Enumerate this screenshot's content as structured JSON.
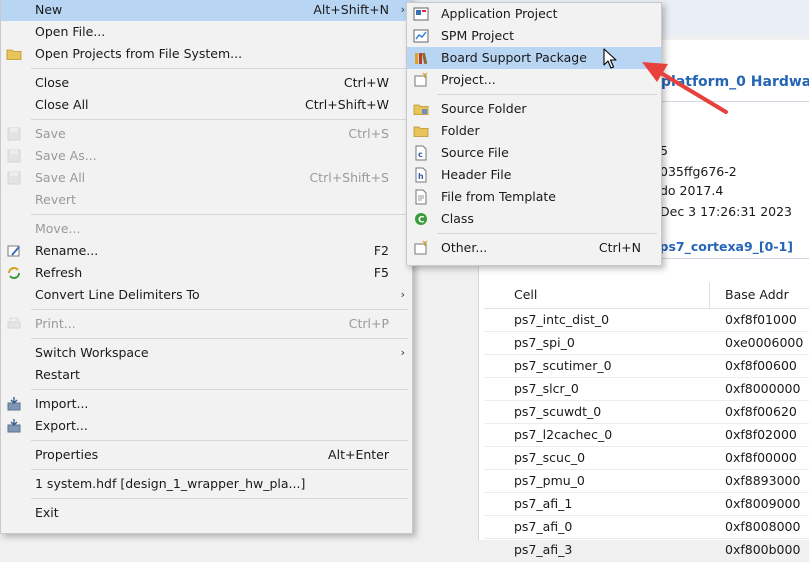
{
  "background": {
    "editor_title": "platform_0 Hardwa",
    "info_lines": [
      "5",
      "035ffg676-2",
      "do 2017.4",
      "Dec  3 17:26:31 2023"
    ],
    "section_link": "r ps7_cortexa9_[0-1]",
    "table": {
      "headers": [
        "Cell",
        "Base Addr"
      ],
      "rows": [
        [
          "ps7_intc_dist_0",
          "0xf8f01000"
        ],
        [
          "ps7_spi_0",
          "0xe0006000"
        ],
        [
          "ps7_scutimer_0",
          "0xf8f00600"
        ],
        [
          "ps7_slcr_0",
          "0xf8000000"
        ],
        [
          "ps7_scuwdt_0",
          "0xf8f00620"
        ],
        [
          "ps7_l2cachec_0",
          "0xf8f02000"
        ],
        [
          "ps7_scuc_0",
          "0xf8f00000"
        ],
        [
          "ps7_pmu_0",
          "0xf8893000"
        ],
        [
          "ps7_afi_1",
          "0xf8009000"
        ],
        [
          "ps7_afi_0",
          "0xf8008000"
        ],
        [
          "ps7_afi_3",
          "0xf800b000"
        ]
      ]
    }
  },
  "main_menu": [
    {
      "label": "New",
      "accel": "Alt+Shift+N",
      "submenu": true,
      "highlighted": true,
      "icon": ""
    },
    {
      "label": "Open File...",
      "accel": "",
      "icon": ""
    },
    {
      "label": "Open Projects from File System...",
      "accel": "",
      "icon": "folder-icon"
    },
    {
      "separator": true
    },
    {
      "label": "Close",
      "accel": "Ctrl+W",
      "icon": ""
    },
    {
      "label": "Close All",
      "accel": "Ctrl+Shift+W",
      "icon": ""
    },
    {
      "separator": true
    },
    {
      "label": "Save",
      "accel": "Ctrl+S",
      "disabled": true,
      "icon": "save-icon"
    },
    {
      "label": "Save As...",
      "accel": "",
      "disabled": true,
      "icon": "save-as-icon"
    },
    {
      "label": "Save All",
      "accel": "Ctrl+Shift+S",
      "disabled": true,
      "icon": "save-all-icon"
    },
    {
      "label": "Revert",
      "accel": "",
      "disabled": true,
      "icon": ""
    },
    {
      "separator": true
    },
    {
      "label": "Move...",
      "accel": "",
      "disabled": true,
      "icon": ""
    },
    {
      "label": "Rename...",
      "accel": "F2",
      "icon": "rename-icon"
    },
    {
      "label": "Refresh",
      "accel": "F5",
      "icon": "refresh-icon"
    },
    {
      "label": "Convert Line Delimiters To",
      "accel": "",
      "submenu": true,
      "icon": ""
    },
    {
      "separator": true
    },
    {
      "label": "Print...",
      "accel": "Ctrl+P",
      "disabled": true,
      "icon": "print-icon"
    },
    {
      "separator": true
    },
    {
      "label": "Switch Workspace",
      "accel": "",
      "submenu": true,
      "icon": ""
    },
    {
      "label": "Restart",
      "accel": "",
      "icon": ""
    },
    {
      "separator": true
    },
    {
      "label": "Import...",
      "accel": "",
      "icon": "import-icon"
    },
    {
      "label": "Export...",
      "accel": "",
      "icon": "export-icon"
    },
    {
      "separator": true
    },
    {
      "label": "Properties",
      "accel": "Alt+Enter",
      "icon": ""
    },
    {
      "separator": true
    },
    {
      "label": "1 system.hdf  [design_1_wrapper_hw_pla...]",
      "accel": "",
      "icon": ""
    },
    {
      "separator": true
    },
    {
      "label": "Exit",
      "accel": "",
      "icon": ""
    }
  ],
  "sub_menu": [
    {
      "label": "Application Project",
      "accel": "",
      "icon": "application-project-icon"
    },
    {
      "label": "SPM Project",
      "accel": "",
      "icon": "spm-project-icon"
    },
    {
      "label": "Board Support Package",
      "accel": "",
      "highlighted": true,
      "icon": "bsp-icon"
    },
    {
      "label": "Project...",
      "accel": "",
      "icon": "project-icon"
    },
    {
      "separator": true
    },
    {
      "label": "Source Folder",
      "accel": "",
      "icon": "source-folder-icon"
    },
    {
      "label": "Folder",
      "accel": "",
      "icon": "folder-icon"
    },
    {
      "label": "Source File",
      "accel": "",
      "icon": "source-file-icon"
    },
    {
      "label": "Header File",
      "accel": "",
      "icon": "header-file-icon"
    },
    {
      "label": "File from Template",
      "accel": "",
      "icon": "file-template-icon"
    },
    {
      "label": "Class",
      "accel": "",
      "icon": "class-icon"
    },
    {
      "separator": true
    },
    {
      "label": "Other...",
      "accel": "Ctrl+N",
      "icon": "other-wizard-icon"
    }
  ],
  "colors": {
    "highlight": "#b8d5f3",
    "link_blue": "#2565b6",
    "annotation_red": "#e8413c"
  }
}
